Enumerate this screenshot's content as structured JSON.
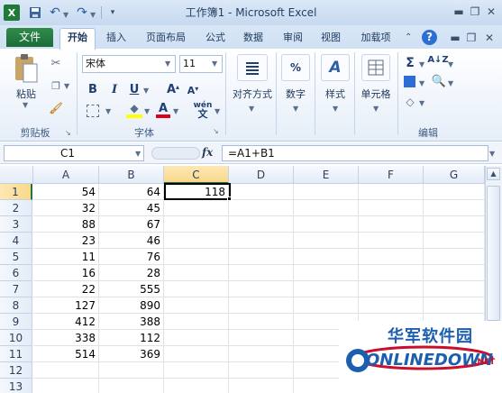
{
  "window": {
    "title": "工作簿1 - Microsoft Excel"
  },
  "tabs": [
    "文件",
    "开始",
    "插入",
    "页面布局",
    "公式",
    "数据",
    "审阅",
    "视图",
    "加载项"
  ],
  "ribbon": {
    "clipboard": {
      "paste_label": "粘贴",
      "group_label": "剪贴板"
    },
    "font": {
      "font_name": "宋体",
      "font_size": "11",
      "group_label": "字体"
    },
    "alignment": {
      "label": "对齐方式"
    },
    "number": {
      "label": "数字",
      "icon_text": "%"
    },
    "styles": {
      "label": "样式"
    },
    "cells": {
      "label": "单元格"
    },
    "editing": {
      "group_label": "编辑"
    }
  },
  "formula_bar": {
    "name_box": "C1",
    "fx": "fx",
    "formula": "=A1+B1"
  },
  "columns": [
    "A",
    "B",
    "C",
    "D",
    "E",
    "F",
    "G"
  ],
  "rows": [
    {
      "num": "1",
      "a": "54",
      "b": "64",
      "c": "118"
    },
    {
      "num": "2",
      "a": "32",
      "b": "45",
      "c": ""
    },
    {
      "num": "3",
      "a": "88",
      "b": "67",
      "c": ""
    },
    {
      "num": "4",
      "a": "23",
      "b": "46",
      "c": ""
    },
    {
      "num": "5",
      "a": "11",
      "b": "76",
      "c": ""
    },
    {
      "num": "6",
      "a": "16",
      "b": "28",
      "c": ""
    },
    {
      "num": "7",
      "a": "22",
      "b": "555",
      "c": ""
    },
    {
      "num": "8",
      "a": "127",
      "b": "890",
      "c": ""
    },
    {
      "num": "9",
      "a": "412",
      "b": "388",
      "c": ""
    },
    {
      "num": "10",
      "a": "338",
      "b": "112",
      "c": ""
    },
    {
      "num": "11",
      "a": "514",
      "b": "369",
      "c": ""
    },
    {
      "num": "12",
      "a": "",
      "b": "",
      "c": ""
    },
    {
      "num": "13",
      "a": "",
      "b": "",
      "c": ""
    }
  ],
  "watermark": {
    "cn": "华军软件园",
    "en": "ONLINEDOWN",
    "net": ".NET"
  },
  "colors": {
    "file_tab": "#1d6c38",
    "selection": "#217346",
    "ribbon_bg": "#dbe8f6"
  }
}
